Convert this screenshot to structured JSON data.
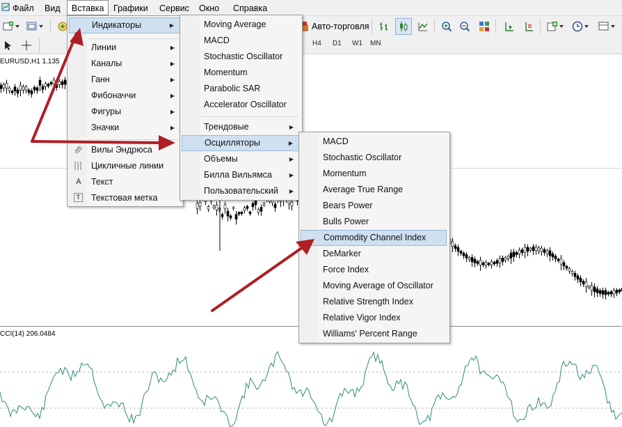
{
  "menubar": {
    "items": [
      {
        "label": "Файл"
      },
      {
        "label": "Вид"
      },
      {
        "label": "Вставка"
      },
      {
        "label": "Графики"
      },
      {
        "label": "Сервис"
      },
      {
        "label": "Окно"
      },
      {
        "label": "Справка"
      }
    ],
    "active": "Вставка"
  },
  "toolbar": {
    "autotrade_label": "Авто-торговля",
    "periods": [
      "H4",
      "D1",
      "W1",
      "MN"
    ]
  },
  "chart": {
    "symbol_label": "EURUSD,H1  1.135",
    "indicator_label": "CCI(14) 206.0484"
  },
  "insert_menu": {
    "items": [
      {
        "label": "Индикаторы",
        "submenu": true,
        "highlighted": true
      },
      {
        "label": "Линии",
        "submenu": true
      },
      {
        "label": "Каналы",
        "submenu": true
      },
      {
        "label": "Ганн",
        "submenu": true
      },
      {
        "label": "Фибоначчи",
        "submenu": true
      },
      {
        "label": "Фигуры",
        "submenu": true
      },
      {
        "label": "Значки",
        "submenu": true
      },
      {
        "label": "Вилы Эндрюса",
        "icon": "andrews-pitchfork-icon"
      },
      {
        "label": "Цикличные линии",
        "icon": "cycle-lines-icon"
      },
      {
        "label": "Текст",
        "icon": "text-icon",
        "icon_glyph": "A"
      },
      {
        "label": "Текстовая метка",
        "icon": "text-label-icon",
        "icon_glyph": "T"
      }
    ]
  },
  "indicators_menu": {
    "items": [
      {
        "label": "Moving Average"
      },
      {
        "label": "MACD"
      },
      {
        "label": "Stochastic Oscillator"
      },
      {
        "label": "Momentum"
      },
      {
        "label": "Parabolic SAR"
      },
      {
        "label": "Accelerator Oscillator"
      },
      {
        "label": "Трендовые",
        "submenu": true
      },
      {
        "label": "Осцилляторы",
        "submenu": true,
        "highlighted": true
      },
      {
        "label": "Объемы",
        "submenu": true
      },
      {
        "label": "Билла Вильямса",
        "submenu": true
      },
      {
        "label": "Пользовательский",
        "submenu": true
      }
    ]
  },
  "oscillators_menu": {
    "items": [
      {
        "label": "MACD"
      },
      {
        "label": "Stochastic Oscillator"
      },
      {
        "label": "Momentum"
      },
      {
        "label": "Average True Range"
      },
      {
        "label": "Bears Power"
      },
      {
        "label": "Bulls Power"
      },
      {
        "label": "Commodity Channel Index",
        "highlighted": true
      },
      {
        "label": "DeMarker"
      },
      {
        "label": "Force Index"
      },
      {
        "label": "Moving Average of Oscillator"
      },
      {
        "label": "Relative Strength Index"
      },
      {
        "label": "Relative Vigor Index"
      },
      {
        "label": "Williams' Percent Range"
      }
    ]
  },
  "colors": {
    "arrow": "#b01e23",
    "highlight": "#cfe0f0",
    "cci_line": "#2e8b7a",
    "candle": "#000000"
  }
}
